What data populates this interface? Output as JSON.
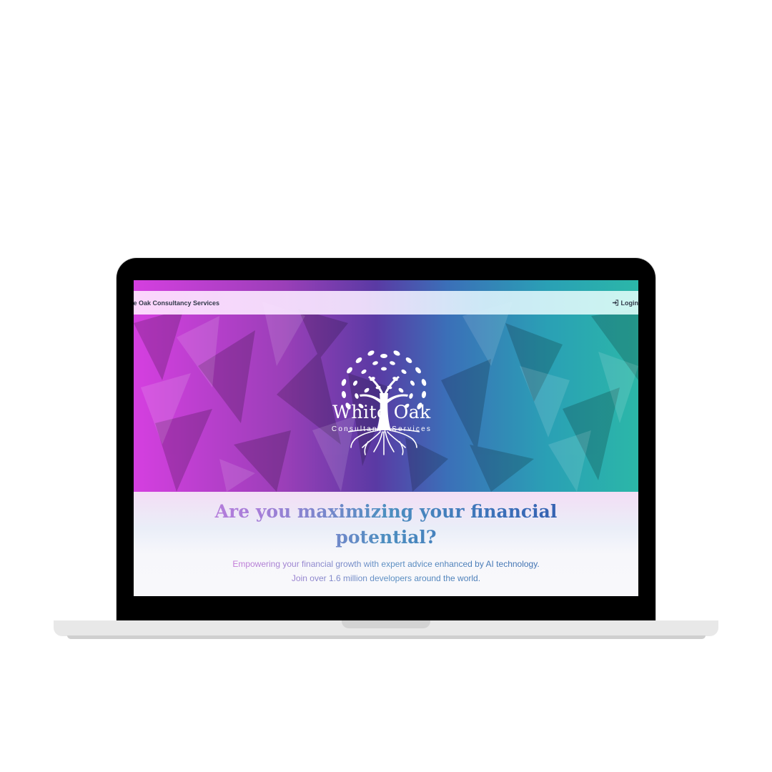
{
  "navbar": {
    "brand": "ite Oak Consultancy Services",
    "login_label": "Login"
  },
  "logo": {
    "title": "White Oak",
    "subtitle": "Consultancy Services"
  },
  "hero_text": {
    "headline": "Are you maximizing your financial potential?",
    "tagline_line1": "Empowering your financial growth with expert advice enhanced by AI technology.",
    "tagline_line2": "Join over 1.6 million developers around the world."
  },
  "icons": {
    "login": "sign-in-icon",
    "logo": "oak-tree-icon"
  },
  "colors": {
    "gradient_left": "#d53fe0",
    "gradient_mid": "#5a3aa4",
    "gradient_right": "#2bb7a8",
    "text_dark": "#333a4a"
  }
}
